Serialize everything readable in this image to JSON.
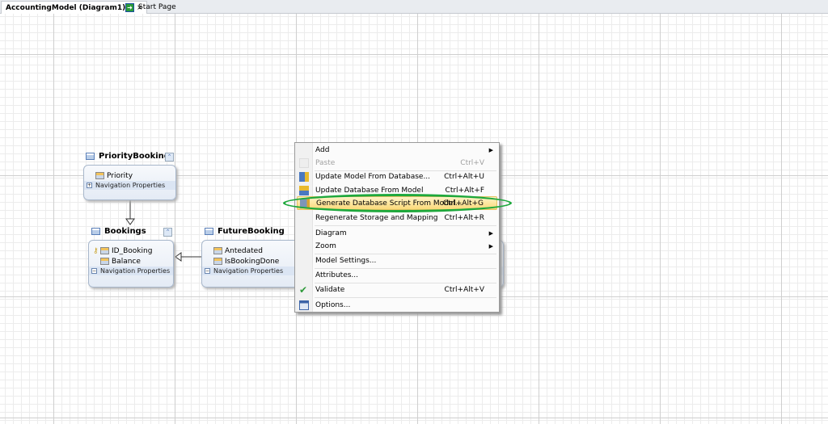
{
  "tabs": [
    {
      "label": "AccountingModel (Diagram1)*",
      "close": "×"
    },
    {
      "label": "Start Page"
    }
  ],
  "entities": {
    "priority_booking": {
      "title": "PriorityBooking",
      "properties": [
        "Priority"
      ],
      "nav": "Navigation Properties"
    },
    "bookings": {
      "title": "Bookings",
      "properties": [
        "ID_Booking",
        "Balance"
      ],
      "nav": "Navigation Properties"
    },
    "future_booking": {
      "title": "FutureBooking",
      "properties": [
        "Antedated",
        "IsBookingDone"
      ],
      "nav": "Navigation Properties"
    }
  },
  "context_menu": {
    "items": [
      {
        "label": "Add",
        "shortcut": "",
        "submenu": true
      },
      {
        "label": "Paste",
        "shortcut": "Ctrl+V",
        "disabled": true,
        "icon": "paste-icon"
      },
      {
        "label": "Update Model From Database...",
        "shortcut": "Ctrl+Alt+U",
        "icon": "update-model-icon"
      },
      {
        "label": "Update Database From Model",
        "shortcut": "Ctrl+Alt+F",
        "icon": "update-database-icon"
      },
      {
        "label": "Generate Database Script From Model...",
        "shortcut": "Ctrl+Alt+G",
        "highlighted": true,
        "icon": "generate-script-icon"
      },
      {
        "label": "Regenerate Storage and Mapping",
        "shortcut": "Ctrl+Alt+R"
      },
      {
        "label": "Diagram",
        "shortcut": "",
        "submenu": true
      },
      {
        "label": "Zoom",
        "shortcut": "",
        "submenu": true
      },
      {
        "label": "Model Settings...",
        "shortcut": ""
      },
      {
        "label": "Attributes...",
        "shortcut": ""
      },
      {
        "label": "Validate",
        "shortcut": "Ctrl+Alt+V",
        "icon": "checkmark-icon"
      },
      {
        "label": "Options...",
        "shortcut": "",
        "icon": "options-icon"
      }
    ]
  },
  "colors": {
    "highlight_ellipse": "#1ea83c",
    "menu_highlight": "#fbd97a"
  }
}
